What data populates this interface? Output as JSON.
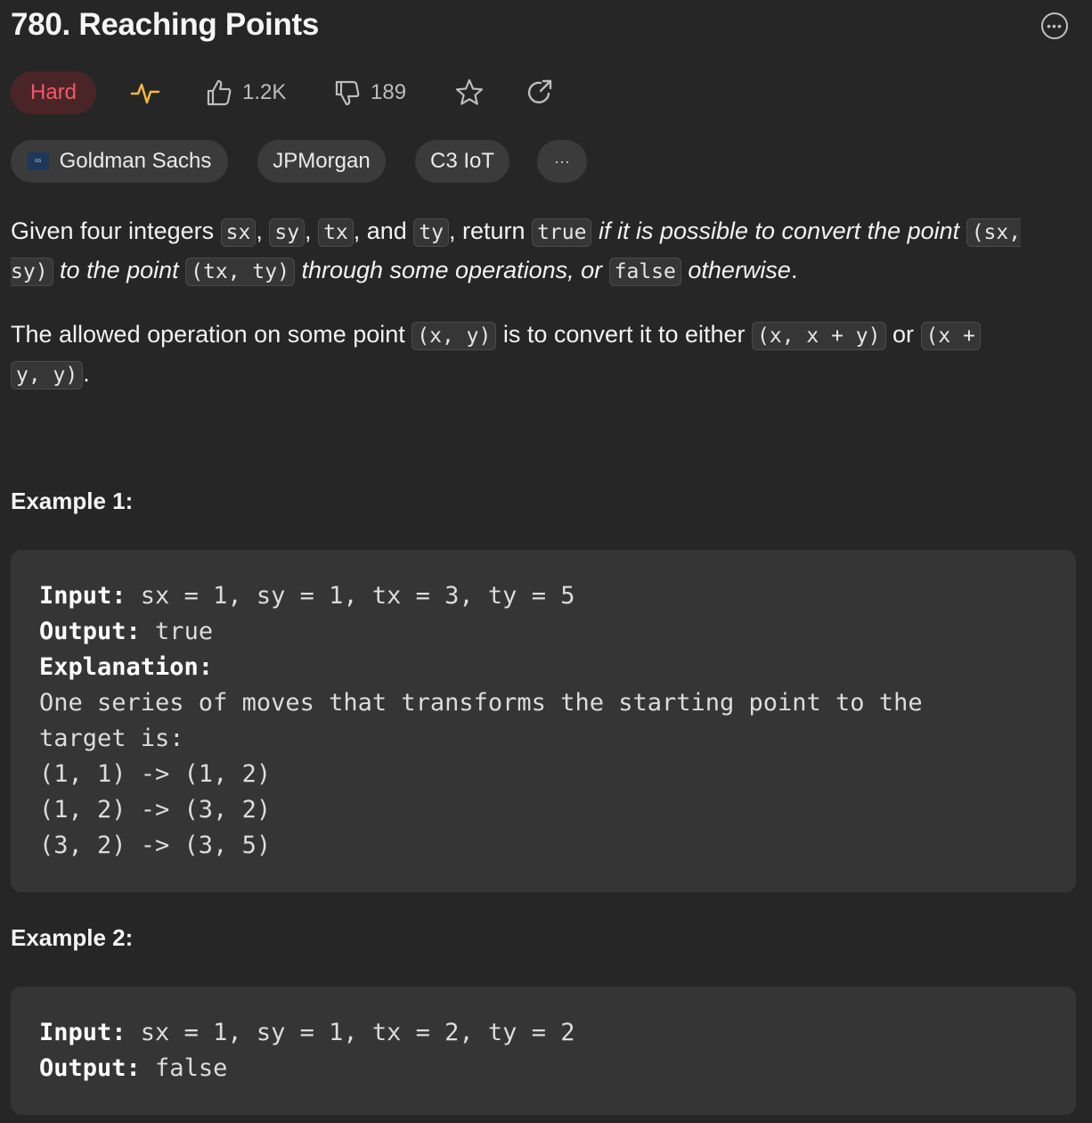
{
  "problem": {
    "title": "780. Reaching Points",
    "difficulty": "Hard",
    "likes": "1.2K",
    "dislikes": "189",
    "companies": [
      "Goldman Sachs",
      "JPMorgan",
      "C3 IoT"
    ],
    "more_tags_label": "···",
    "logo_text": "Goldman Sachs"
  },
  "description": {
    "p1": {
      "t1": "Given four integers ",
      "c1": "sx",
      "t2": ", ",
      "c2": "sy",
      "t3": ", ",
      "c3": "tx",
      "t4": ", and ",
      "c4": "ty",
      "t5": ", return ",
      "c5": "true",
      "i1": " if it is possible to convert the point ",
      "c6": "(sx, sy)",
      "i2": " to the point ",
      "c7": "(tx, ty)",
      "i3": " through some operations, or ",
      "c8": "false",
      "i4": " otherwise",
      "t6": "."
    },
    "p2": {
      "t1": "The allowed operation on some point ",
      "c1": "(x, y)",
      "t2": " is to convert it to either ",
      "c2": "(x, x + y)",
      "t3": " or ",
      "c3": "(x +",
      "c4": "y, y)",
      "t4": "."
    }
  },
  "examples": [
    {
      "title": "Example 1:",
      "input_label": "Input:",
      "input": " sx = 1, sy = 1, tx = 3, ty = 5",
      "output_label": "Output:",
      "output": " true",
      "explanation_label": "Explanation:",
      "explanation_lines": [
        "One series of moves that transforms the starting point to the",
        "target is:",
        "(1, 1) -> (1, 2)",
        "(1, 2) -> (3, 2)",
        "(3, 2) -> (3, 5)"
      ]
    },
    {
      "title": "Example 2:",
      "input_label": "Input:",
      "input": " sx = 1, sy = 1, tx = 2, ty = 2",
      "output_label": "Output:",
      "output": " false"
    }
  ],
  "colors": {
    "background": "#262626",
    "hard": "#f0596a",
    "hard_bg": "#4a2528",
    "code_bg": "#353535"
  },
  "icons": [
    "more-options-icon",
    "activity-icon",
    "thumbs-up-icon",
    "thumbs-down-icon",
    "star-icon",
    "share-icon"
  ]
}
